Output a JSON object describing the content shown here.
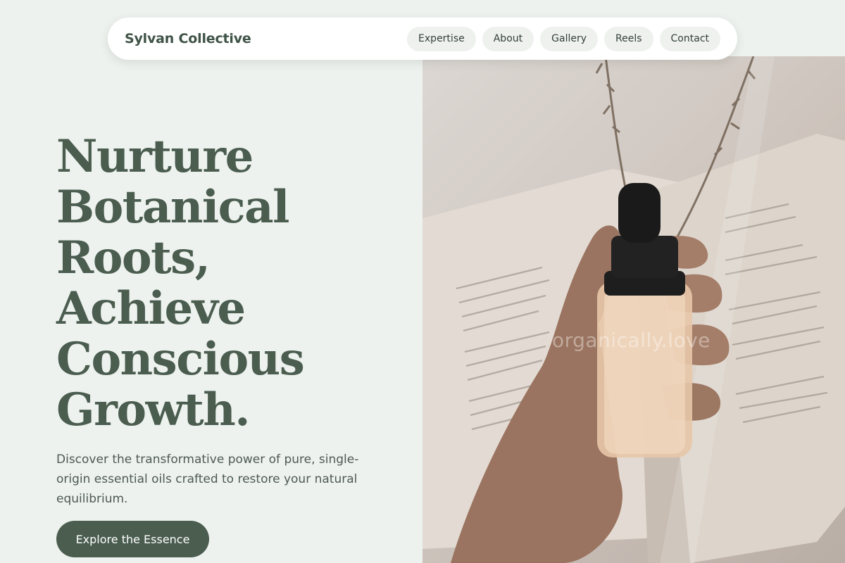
{
  "brand": "Sylvan Collective",
  "nav": {
    "links": [
      "Expertise",
      "About",
      "Gallery",
      "Reels",
      "Contact"
    ]
  },
  "hero": {
    "headline_lines": [
      "Nurture",
      "Botanical",
      "Roots,",
      "Achieve",
      "Conscious",
      "Growth."
    ],
    "lead": "Discover the transformative power of pure, single-origin essential oils crafted to restore your natural equilibrium.",
    "cta_label": "Explore the Essence"
  },
  "photo": {
    "watermark": "organically.love",
    "subject": "hand holding dropper bottle over open book with dried grass"
  },
  "colors": {
    "background": "#eef2ef",
    "accent": "#4a5d4f",
    "nav_bg": "#ffffff",
    "pill_bg": "#eef1ee"
  }
}
